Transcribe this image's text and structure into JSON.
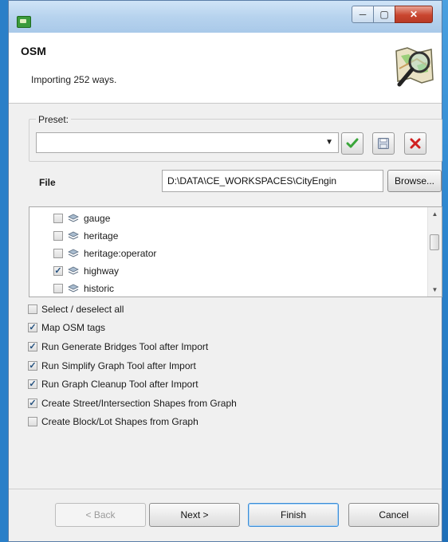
{
  "window": {
    "minimize_glyph": "─",
    "maximize_glyph": "▢",
    "close_glyph": "✕"
  },
  "header": {
    "title": "OSM",
    "description": "Importing 252 ways.",
    "logo_icon": "osm-map-magnifier"
  },
  "preset": {
    "legend": "Preset:",
    "value": "",
    "dropdown_glyph": "▼",
    "buttons": [
      {
        "name": "apply-preset",
        "icon": "checkmark-icon"
      },
      {
        "name": "save-preset",
        "icon": "floppy-disk-icon"
      },
      {
        "name": "delete-preset",
        "icon": "red-x-icon"
      }
    ]
  },
  "file": {
    "label": "File",
    "value": "D:\\DATA\\CE_WORKSPACES\\CityEngin",
    "browse_label": "Browse..."
  },
  "tags": {
    "items": [
      {
        "label": "gauge",
        "checked": false
      },
      {
        "label": "heritage",
        "checked": false
      },
      {
        "label": "heritage:operator",
        "checked": false
      },
      {
        "label": "highway",
        "checked": true
      },
      {
        "label": "historic",
        "checked": false
      }
    ],
    "scroll_up_glyph": "▲",
    "scroll_down_glyph": "▼"
  },
  "options": [
    {
      "label": "Select / deselect all",
      "checked": false
    },
    {
      "label": "Map OSM tags",
      "checked": true
    },
    {
      "label": "Run Generate Bridges Tool after Import",
      "checked": true
    },
    {
      "label": "Run Simplify Graph Tool after Import",
      "checked": true
    },
    {
      "label": "Run Graph Cleanup Tool after Import",
      "checked": true
    },
    {
      "label": "Create Street/Intersection Shapes from Graph",
      "checked": true
    },
    {
      "label": "Create Block/Lot Shapes from Graph",
      "checked": false
    }
  ],
  "footer": {
    "back_label": "< Back",
    "next_label": "Next >",
    "finish_label": "Finish",
    "cancel_label": "Cancel"
  },
  "check_glyph": "✓",
  "colors": {
    "title_bar": "#b7d3ee",
    "close_button": "#c9462f",
    "check_green": "#3aa63a",
    "delete_red": "#d02020"
  }
}
